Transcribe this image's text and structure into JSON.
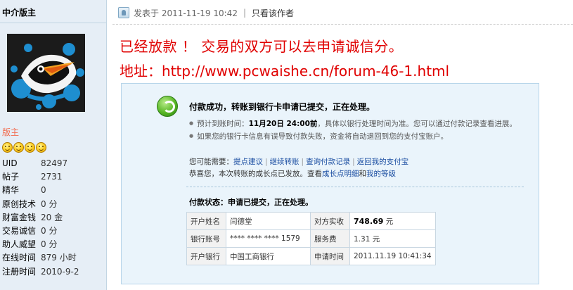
{
  "user": {
    "name": "中介版主",
    "role": "版主",
    "stats": [
      {
        "key": "UID",
        "value": "82497"
      },
      {
        "key": "帖子",
        "value": "2731"
      },
      {
        "key": "精华",
        "value": "0"
      },
      {
        "key": "原创技术",
        "value": "0 分"
      },
      {
        "key": "财富金钱",
        "value": "20 金"
      },
      {
        "key": "交易诚信",
        "value": "0 分"
      },
      {
        "key": "助人威望",
        "value": "0 分"
      },
      {
        "key": "在线时间",
        "value": "879 小时"
      },
      {
        "key": "注册时间",
        "value": "2010-9-2"
      }
    ]
  },
  "post": {
    "posted_at": "发表于 2011-11-19 10:42",
    "only_author": "只看该作者",
    "message_line1": "已经放款 ！ 交易的双方可以去申请诚信分。",
    "message_line2": "地址：http://www.pcwaishe.cn/forum-46-1.html"
  },
  "payment": {
    "title": "付款成功，转账到银行卡申请已提交，正在处理。",
    "bullet1_prefix": "预计到账时间：",
    "bullet1_time": "11月20日 24:00前",
    "bullet1_suffix": "，具体以银行处理时间为准。您可以通过付款记录查看进展。",
    "bullet2": "如果您的银行卡信息有误导致付款失败，资金将自动退回到您的支付宝账户。",
    "may_need": "您可能需要：",
    "links": [
      "提点建议",
      "继续转账",
      "查询付款记录",
      "返回我的支付宝"
    ],
    "congrats_prefix": "恭喜您，本次转账的成长点已发放。查看",
    "congrats_link1": "成长点明细",
    "congrats_and": "和",
    "congrats_link2": "我的等级",
    "status": "付款状态：申请已提交，正在处理。",
    "table": {
      "r1": [
        "开户姓名",
        "闫德堂",
        "对方实收",
        "748.69",
        "元"
      ],
      "r2": [
        "银行账号",
        "**** **** **** 1579",
        "服务费",
        "1.31 元"
      ],
      "r3": [
        "开户银行",
        "中国工商银行",
        "申请时间",
        "2011.11.19 10:41:34"
      ]
    }
  },
  "colors": {
    "sidebar_bg": "#e6eef6",
    "message_red": "#e00000",
    "link_blue": "#1a4da1",
    "role_orange": "#f26c4f"
  }
}
